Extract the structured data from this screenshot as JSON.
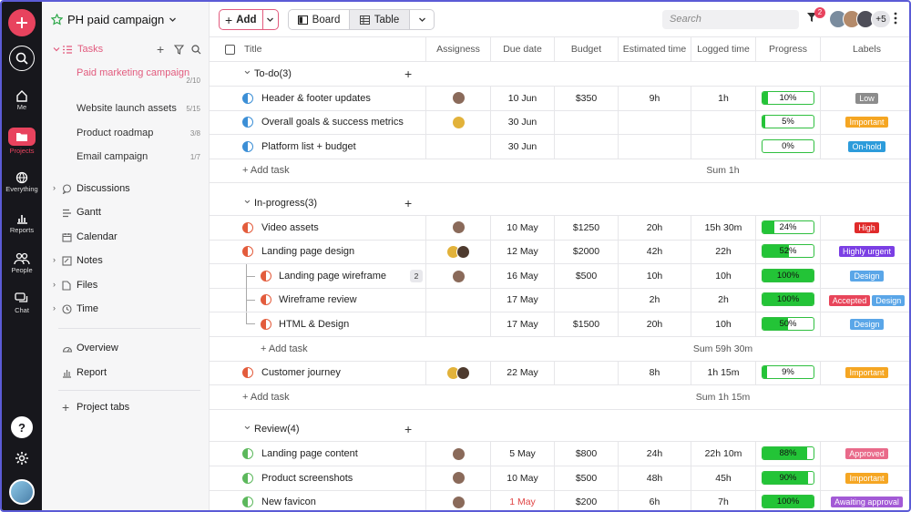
{
  "project": {
    "title": "PH paid campaign"
  },
  "rail": {
    "me": "Me",
    "projects": "Projects",
    "everything": "Everything",
    "reports": "Reports",
    "people": "People",
    "chat": "Chat"
  },
  "sidebar": {
    "tasks": "Tasks",
    "task_lists": [
      {
        "label": "Paid marketing campaign",
        "count": "2/10"
      },
      {
        "label": "Website launch assets",
        "count": "5/15"
      },
      {
        "label": "Product roadmap",
        "count": "3/8"
      },
      {
        "label": "Email campaign",
        "count": "1/7"
      }
    ],
    "discussions": "Discussions",
    "gantt": "Gantt",
    "calendar": "Calendar",
    "notes": "Notes",
    "files": "Files",
    "time": "Time",
    "overview": "Overview",
    "report": "Report",
    "project_tabs": "Project tabs"
  },
  "toolbar": {
    "add": "Add",
    "board": "Board",
    "table": "Table",
    "search_placeholder": "Search",
    "filter_badge": "2",
    "more_avatars": "+5"
  },
  "columns": [
    "Title",
    "Assigness",
    "Due date",
    "Budget",
    "Estimated time",
    "Logged time",
    "Progress",
    "Labels"
  ],
  "groups": [
    {
      "name": "To-do(3)",
      "sum": "Sum 1h",
      "add_task": "Add task"
    },
    {
      "name": "In-progress(3)",
      "sum": "Sum 59h 30m",
      "add_task": "Add task"
    },
    {
      "name": "Review(4)"
    }
  ],
  "sub_add_task": "Add task",
  "cust_sum": "Sum 1h 15m",
  "tasks": {
    "t1": {
      "title": "Header & footer updates",
      "due": "10 Jun",
      "budget": "$350",
      "est": "9h",
      "logged": "1h",
      "progress": 10,
      "progress_label": "10%",
      "labels": [
        "Low"
      ]
    },
    "t2": {
      "title": "Overall goals & success metrics",
      "due": "30 Jun",
      "budget": "",
      "est": "",
      "logged": "",
      "progress": 5,
      "progress_label": "5%",
      "labels": [
        "Important"
      ]
    },
    "t3": {
      "title": "Platform list + budget",
      "due": "30 Jun",
      "budget": "",
      "est": "",
      "logged": "",
      "progress": 0,
      "progress_label": "0%",
      "labels": [
        "On-hold"
      ]
    },
    "t4": {
      "title": "Video assets",
      "due": "10 May",
      "budget": "$1250",
      "est": "20h",
      "logged": "15h 30m",
      "progress": 24,
      "progress_label": "24%",
      "labels": [
        "High"
      ]
    },
    "t5": {
      "title": "Landing page design",
      "due": "12 May",
      "budget": "$2000",
      "est": "42h",
      "logged": "22h",
      "progress": 52,
      "progress_label": "52%",
      "labels": [
        "Highly urgent"
      ]
    },
    "t6": {
      "title": "Landing page wireframe",
      "subtasks": "2",
      "due": "16 May",
      "budget": "$500",
      "est": "10h",
      "logged": "10h",
      "progress": 100,
      "progress_label": "100%",
      "labels": [
        "Design"
      ]
    },
    "t7": {
      "title": "Wireframe review",
      "due": "17 May",
      "budget": "",
      "est": "2h",
      "logged": "2h",
      "progress": 100,
      "progress_label": "100%",
      "labels": [
        "Accepted",
        "Design"
      ]
    },
    "t8": {
      "title": "HTML & Design",
      "due": "17 May",
      "budget": "$1500",
      "est": "20h",
      "logged": "10h",
      "progress": 50,
      "progress_label": "50%",
      "labels": [
        "Design"
      ]
    },
    "t9": {
      "title": "Customer journey",
      "due": "22 May",
      "budget": "",
      "est": "8h",
      "logged": "1h 15m",
      "progress": 9,
      "progress_label": "9%",
      "labels": [
        "Important"
      ]
    },
    "t10": {
      "title": "Landing page content",
      "due": "5 May",
      "budget": "$800",
      "est": "24h",
      "logged": "22h 10m",
      "progress": 88,
      "progress_label": "88%",
      "labels": [
        "Approved"
      ]
    },
    "t11": {
      "title": "Product screenshots",
      "due": "10 May",
      "budget": "$500",
      "est": "48h",
      "logged": "45h",
      "progress": 90,
      "progress_label": "90%",
      "labels": [
        "Important"
      ]
    },
    "t12": {
      "title": "New favicon",
      "due": "1 May",
      "budget": "$200",
      "est": "6h",
      "logged": "7h",
      "progress": 100,
      "progress_label": "100%",
      "labels": [
        "Awaiting approval"
      ]
    }
  },
  "label_colors": {
    "Low": "#8c8c8c",
    "Important": "#f5a623",
    "On-hold": "#2d9cdb",
    "High": "#e02b2b",
    "Highly urgent": "#7b3fe4",
    "Design": "#5aa6e8",
    "Accepted": "#e8455a",
    "Approved": "#e96a8a",
    "Awaiting approval": "#a35ad6"
  },
  "accent": "#e8435e"
}
